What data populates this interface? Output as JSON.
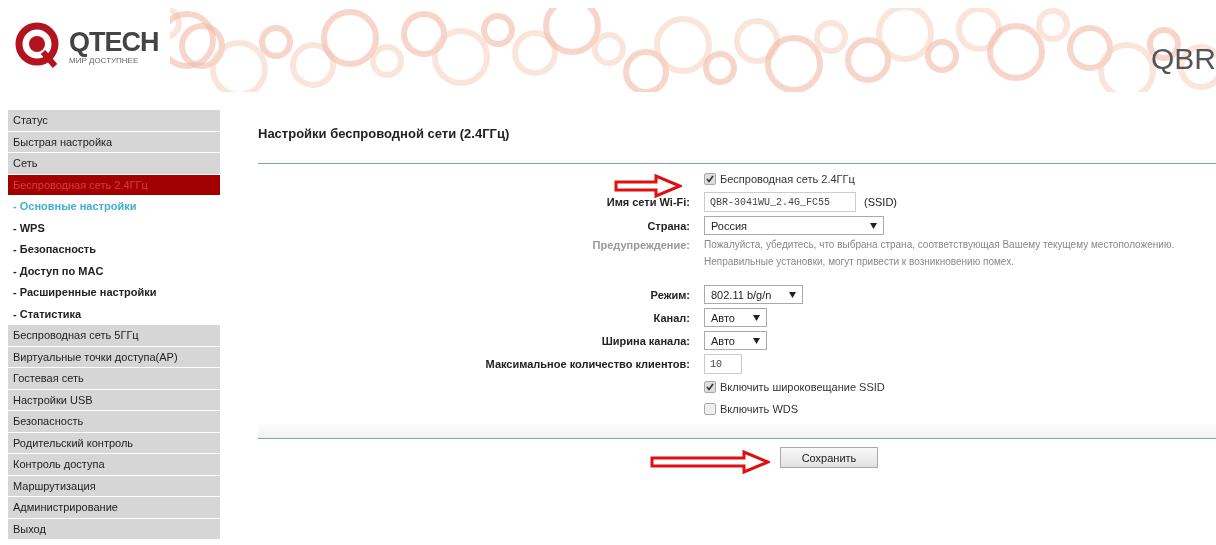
{
  "header": {
    "logo": {
      "name": "QTECH",
      "tagline": "МИР ДОСТУПНЕЕ"
    },
    "model": "QBR"
  },
  "sidebar": {
    "items": [
      {
        "label": "Статус",
        "kind": "section",
        "selected": false
      },
      {
        "label": "Быстрая настройка",
        "kind": "section",
        "selected": false
      },
      {
        "label": "Сеть",
        "kind": "section",
        "selected": false
      },
      {
        "label": "Беспроводная сеть 2.4ГГц",
        "kind": "section",
        "selected": true
      },
      {
        "label": "- Основные настройки",
        "kind": "sub",
        "selected": true
      },
      {
        "label": "- WPS",
        "kind": "sub",
        "selected": false
      },
      {
        "label": "- Безопасность",
        "kind": "sub",
        "selected": false
      },
      {
        "label": "- Доступ по MAC",
        "kind": "sub",
        "selected": false
      },
      {
        "label": "- Расширенные настройки",
        "kind": "sub",
        "selected": false
      },
      {
        "label": "- Статистика",
        "kind": "sub",
        "selected": false
      },
      {
        "label": "Беспроводная сеть 5ГГц",
        "kind": "section",
        "selected": false
      },
      {
        "label": "Виртуальные точки доступа(AP)",
        "kind": "section",
        "selected": false
      },
      {
        "label": "Гостевая сеть",
        "kind": "section",
        "selected": false
      },
      {
        "label": "Настройки USB",
        "kind": "section",
        "selected": false
      },
      {
        "label": "Безопасность",
        "kind": "section",
        "selected": false
      },
      {
        "label": "Родительский контроль",
        "kind": "section",
        "selected": false
      },
      {
        "label": "Контроль доступа",
        "kind": "section",
        "selected": false
      },
      {
        "label": "Маршрутизация",
        "kind": "section",
        "selected": false
      },
      {
        "label": "Администрирование",
        "kind": "section",
        "selected": false
      },
      {
        "label": "Выход",
        "kind": "section",
        "selected": false
      }
    ]
  },
  "page": {
    "title": "Настройки беспроводной сети (2.4ГГц)",
    "fields": [
      {
        "kind": "checkbox",
        "label": "Беспроводная сеть 2.4ГГц",
        "checked": true
      },
      {
        "kind": "text",
        "label": "Имя сети Wi-Fi:",
        "value": "QBR-3041WU_2.4G_FC55",
        "suffix": "(SSID)"
      },
      {
        "kind": "select",
        "label": "Страна:",
        "value": "Россия"
      },
      {
        "kind": "note",
        "label": "Предупреждение:",
        "lines": [
          "Пожалуйста, убедитесь, что выбрана страна, соответствующая Вашему текущему местоположению.",
          "Неправильные установки, могут привести к возникновению помех."
        ]
      },
      {
        "kind": "select",
        "label": "Режим:",
        "value": "802.11 b/g/n"
      },
      {
        "kind": "select",
        "label": "Канал:",
        "value": "Авто"
      },
      {
        "kind": "select",
        "label": "Ширина канала:",
        "value": "Авто"
      },
      {
        "kind": "text",
        "label": "Максимальное количество клиентов:",
        "value": "10"
      },
      {
        "kind": "checkbox",
        "label": "Включить широковещание SSID",
        "checked": true
      },
      {
        "kind": "checkbox",
        "label": "Включить WDS",
        "checked": false
      }
    ],
    "save_button": "Сохранить"
  }
}
